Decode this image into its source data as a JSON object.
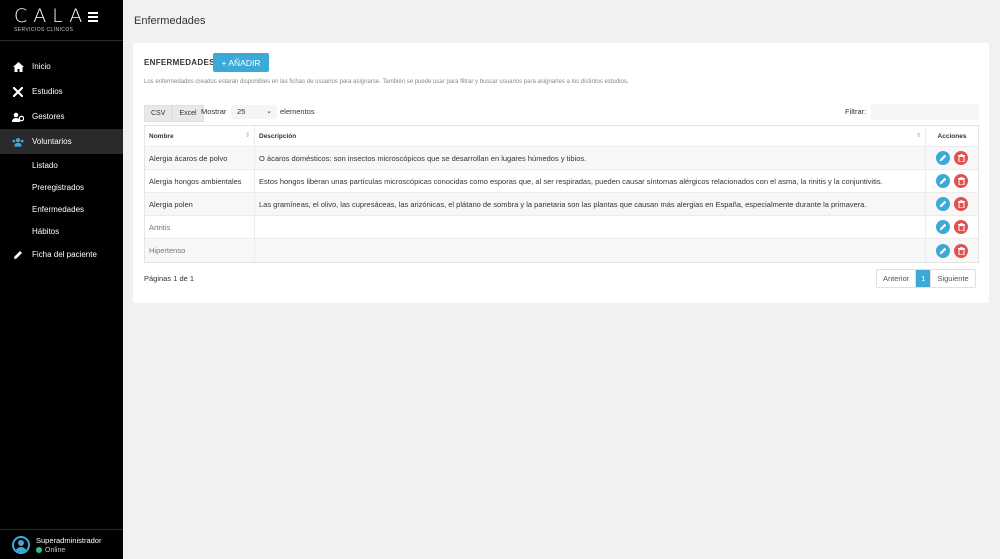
{
  "brand": {
    "name": "CALA",
    "subtitle": "SERVICIOS CLÍNICOS"
  },
  "sidebar": {
    "items": [
      {
        "label": "Inicio",
        "icon": "home-icon"
      },
      {
        "label": "Estudios",
        "icon": "tools-icon"
      },
      {
        "label": "Gestores",
        "icon": "users-cog-icon"
      },
      {
        "label": "Voluntarios",
        "icon": "users-icon"
      }
    ],
    "subitems": [
      {
        "label": "Listado"
      },
      {
        "label": "Preregistrados"
      },
      {
        "label": "Enfermedades"
      },
      {
        "label": "Hábitos"
      }
    ],
    "extra": {
      "label": "Ficha del paciente",
      "icon": "pencil-icon"
    }
  },
  "user": {
    "name": "Superadministrador",
    "status": "Online"
  },
  "page": {
    "title": "Enfermedades"
  },
  "card": {
    "title": "ENFERMEDADES",
    "add_label": "+ AÑADIR",
    "description": "Los enfermedades creados estarán disponibles en las fichas de usuarios para asignarse. También se puede usar para filtrar y buscar usuarios para asignarles a los distintos estudios."
  },
  "controls": {
    "csv": "CSV",
    "excel": "Excel",
    "show_label": "Mostrar",
    "page_size": "25",
    "elements_label": "elementos",
    "filter_label": "Filtrar:"
  },
  "table": {
    "headers": [
      "Nombre",
      "Descripción",
      "Acciones"
    ],
    "rows": [
      {
        "name": "Alergia ácaros de polvo",
        "desc": "O ácaros domésticos: son insectos microscópicos que se desarrollan en lugares húmedos y tibios."
      },
      {
        "name": "Alergia hongos ambientales",
        "desc": "Estos hongos liberan unas partículas microscópicas conocidas como esporas que, al ser respiradas, pueden causar síntomas alérgicos relacionados con el asma, la rinitis y la conjuntivitis."
      },
      {
        "name": "Alergia polen",
        "desc": "Las gramíneas, el olivo, las cupresáceas, las arizónicas, el plátano de sombra y la parietaria son las plantas que causan más alergias en España, especialmente durante la primavera."
      },
      {
        "name": "Artritis",
        "desc": ""
      },
      {
        "name": "Hipertenso",
        "desc": ""
      }
    ]
  },
  "footer": {
    "pages_info": "Páginas 1 de 1",
    "prev": "Anterior",
    "current": "1",
    "next": "Siguiente"
  },
  "colors": {
    "accent": "#3da9d9",
    "danger": "#e05252",
    "online": "#2dbd9a",
    "sidebar": "#000000"
  }
}
